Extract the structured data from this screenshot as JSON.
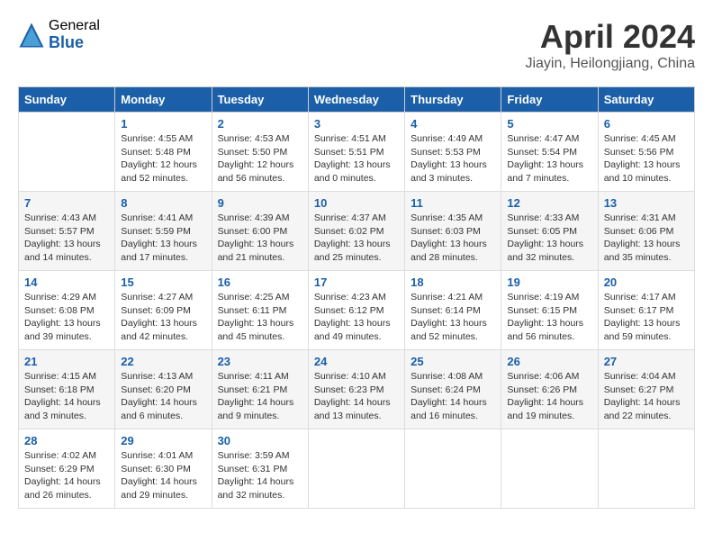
{
  "logo": {
    "general": "General",
    "blue": "Blue"
  },
  "title": "April 2024",
  "location": "Jiayin, Heilongjiang, China",
  "headers": [
    "Sunday",
    "Monday",
    "Tuesday",
    "Wednesday",
    "Thursday",
    "Friday",
    "Saturday"
  ],
  "weeks": [
    [
      {
        "day": "",
        "content": ""
      },
      {
        "day": "1",
        "content": "Sunrise: 4:55 AM\nSunset: 5:48 PM\nDaylight: 12 hours\nand 52 minutes."
      },
      {
        "day": "2",
        "content": "Sunrise: 4:53 AM\nSunset: 5:50 PM\nDaylight: 12 hours\nand 56 minutes."
      },
      {
        "day": "3",
        "content": "Sunrise: 4:51 AM\nSunset: 5:51 PM\nDaylight: 13 hours\nand 0 minutes."
      },
      {
        "day": "4",
        "content": "Sunrise: 4:49 AM\nSunset: 5:53 PM\nDaylight: 13 hours\nand 3 minutes."
      },
      {
        "day": "5",
        "content": "Sunrise: 4:47 AM\nSunset: 5:54 PM\nDaylight: 13 hours\nand 7 minutes."
      },
      {
        "day": "6",
        "content": "Sunrise: 4:45 AM\nSunset: 5:56 PM\nDaylight: 13 hours\nand 10 minutes."
      }
    ],
    [
      {
        "day": "7",
        "content": "Sunrise: 4:43 AM\nSunset: 5:57 PM\nDaylight: 13 hours\nand 14 minutes."
      },
      {
        "day": "8",
        "content": "Sunrise: 4:41 AM\nSunset: 5:59 PM\nDaylight: 13 hours\nand 17 minutes."
      },
      {
        "day": "9",
        "content": "Sunrise: 4:39 AM\nSunset: 6:00 PM\nDaylight: 13 hours\nand 21 minutes."
      },
      {
        "day": "10",
        "content": "Sunrise: 4:37 AM\nSunset: 6:02 PM\nDaylight: 13 hours\nand 25 minutes."
      },
      {
        "day": "11",
        "content": "Sunrise: 4:35 AM\nSunset: 6:03 PM\nDaylight: 13 hours\nand 28 minutes."
      },
      {
        "day": "12",
        "content": "Sunrise: 4:33 AM\nSunset: 6:05 PM\nDaylight: 13 hours\nand 32 minutes."
      },
      {
        "day": "13",
        "content": "Sunrise: 4:31 AM\nSunset: 6:06 PM\nDaylight: 13 hours\nand 35 minutes."
      }
    ],
    [
      {
        "day": "14",
        "content": "Sunrise: 4:29 AM\nSunset: 6:08 PM\nDaylight: 13 hours\nand 39 minutes."
      },
      {
        "day": "15",
        "content": "Sunrise: 4:27 AM\nSunset: 6:09 PM\nDaylight: 13 hours\nand 42 minutes."
      },
      {
        "day": "16",
        "content": "Sunrise: 4:25 AM\nSunset: 6:11 PM\nDaylight: 13 hours\nand 45 minutes."
      },
      {
        "day": "17",
        "content": "Sunrise: 4:23 AM\nSunset: 6:12 PM\nDaylight: 13 hours\nand 49 minutes."
      },
      {
        "day": "18",
        "content": "Sunrise: 4:21 AM\nSunset: 6:14 PM\nDaylight: 13 hours\nand 52 minutes."
      },
      {
        "day": "19",
        "content": "Sunrise: 4:19 AM\nSunset: 6:15 PM\nDaylight: 13 hours\nand 56 minutes."
      },
      {
        "day": "20",
        "content": "Sunrise: 4:17 AM\nSunset: 6:17 PM\nDaylight: 13 hours\nand 59 minutes."
      }
    ],
    [
      {
        "day": "21",
        "content": "Sunrise: 4:15 AM\nSunset: 6:18 PM\nDaylight: 14 hours\nand 3 minutes."
      },
      {
        "day": "22",
        "content": "Sunrise: 4:13 AM\nSunset: 6:20 PM\nDaylight: 14 hours\nand 6 minutes."
      },
      {
        "day": "23",
        "content": "Sunrise: 4:11 AM\nSunset: 6:21 PM\nDaylight: 14 hours\nand 9 minutes."
      },
      {
        "day": "24",
        "content": "Sunrise: 4:10 AM\nSunset: 6:23 PM\nDaylight: 14 hours\nand 13 minutes."
      },
      {
        "day": "25",
        "content": "Sunrise: 4:08 AM\nSunset: 6:24 PM\nDaylight: 14 hours\nand 16 minutes."
      },
      {
        "day": "26",
        "content": "Sunrise: 4:06 AM\nSunset: 6:26 PM\nDaylight: 14 hours\nand 19 minutes."
      },
      {
        "day": "27",
        "content": "Sunrise: 4:04 AM\nSunset: 6:27 PM\nDaylight: 14 hours\nand 22 minutes."
      }
    ],
    [
      {
        "day": "28",
        "content": "Sunrise: 4:02 AM\nSunset: 6:29 PM\nDaylight: 14 hours\nand 26 minutes."
      },
      {
        "day": "29",
        "content": "Sunrise: 4:01 AM\nSunset: 6:30 PM\nDaylight: 14 hours\nand 29 minutes."
      },
      {
        "day": "30",
        "content": "Sunrise: 3:59 AM\nSunset: 6:31 PM\nDaylight: 14 hours\nand 32 minutes."
      },
      {
        "day": "",
        "content": ""
      },
      {
        "day": "",
        "content": ""
      },
      {
        "day": "",
        "content": ""
      },
      {
        "day": "",
        "content": ""
      }
    ]
  ]
}
